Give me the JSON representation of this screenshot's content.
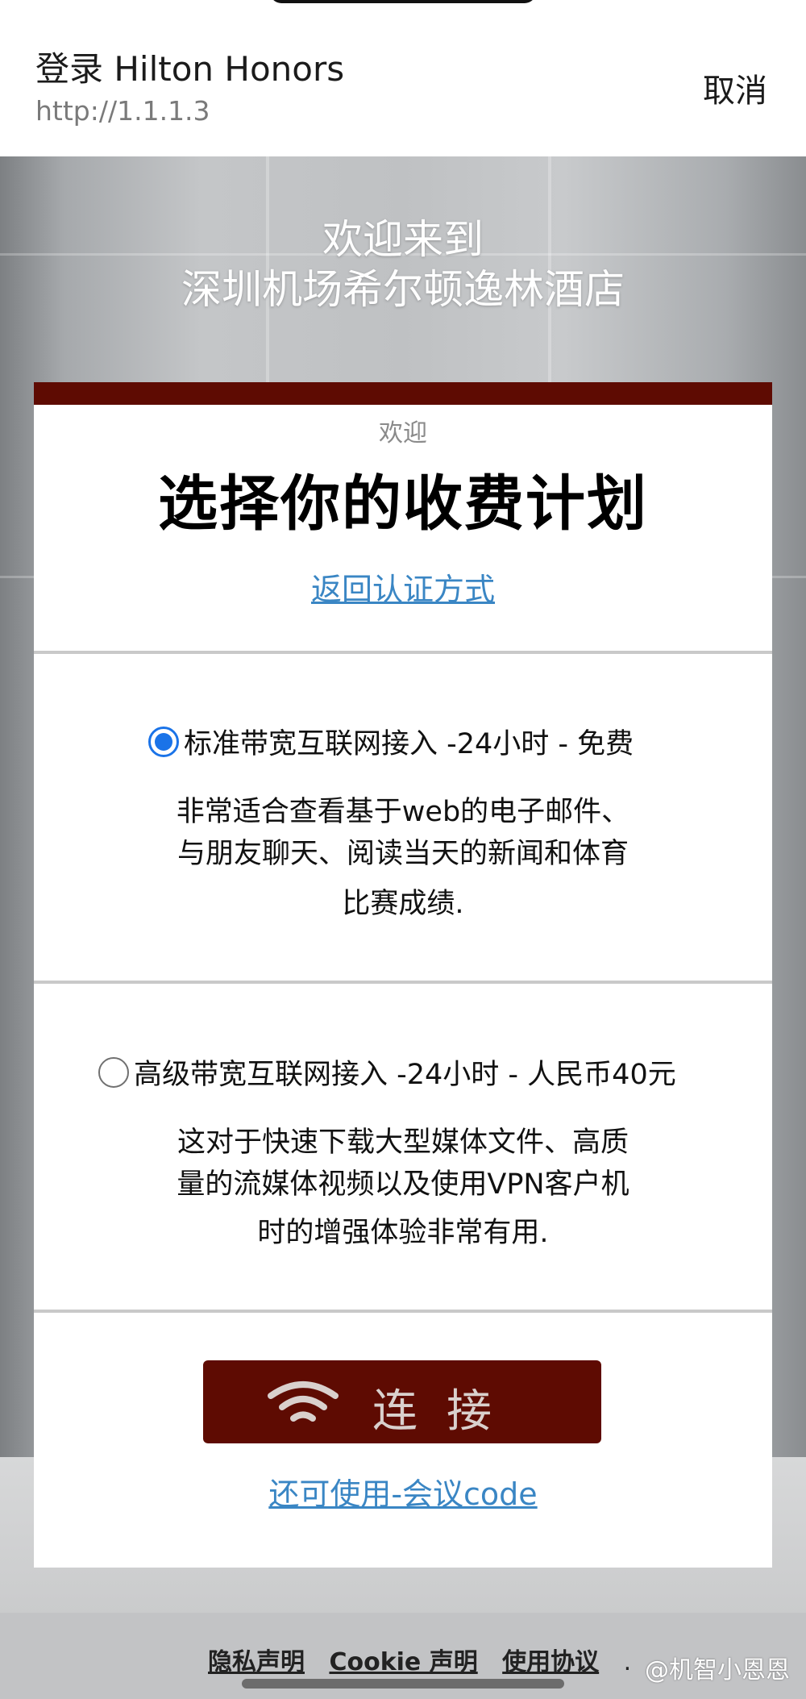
{
  "header": {
    "title": "登录  Hilton Honors",
    "url": "http://1.1.1.3",
    "cancel_label": "取消"
  },
  "hero": {
    "line1": "欢迎来到",
    "line2": "深圳机场希尔顿逸林酒店"
  },
  "card": {
    "welcome": "欢迎",
    "title": "选择你的收费计划",
    "back_link": "返回认证方式"
  },
  "plans": [
    {
      "label": "标准带宽互联网接入 -24小时 - 免费",
      "selected": true,
      "desc_line1": "非常适合查看基于web的电子邮件、",
      "desc_line2": "与朋友聊天、阅读当天的新闻和体育",
      "desc_line3": "比赛成绩."
    },
    {
      "label": "高级带宽互联网接入 -24小时 - 人民币40元",
      "selected": false,
      "desc_line1": "这对于快速下载大型媒体文件、高质",
      "desc_line2": "量的流媒体视频以及使用VPN客户机",
      "desc_line3": "时的增强体验非常有用."
    }
  ],
  "actions": {
    "connect_label": "连接",
    "meeting_link": "还可使用-会议code"
  },
  "footer": {
    "privacy": "隐私声明",
    "cookie": "Cookie 声明",
    "terms": "使用协议",
    "trailing": "."
  },
  "watermark": "@机智小恩恩",
  "colors": {
    "brand": "#5e0b02",
    "link": "#3a86c4",
    "radio_selected": "#1a73e8"
  }
}
